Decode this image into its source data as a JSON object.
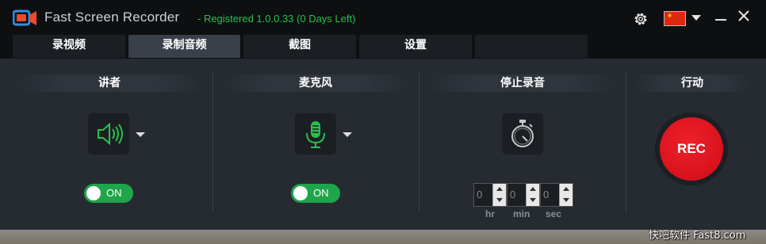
{
  "app": {
    "title": "Fast Screen Recorder",
    "registration": "- Registered 1.0.0.33 (0 Days Left)"
  },
  "titlebar": {
    "icons": [
      "gear-icon",
      "flag-icon",
      "chevron-down-icon",
      "minimize-icon",
      "close-icon"
    ]
  },
  "tabs": [
    {
      "label": "录视频",
      "active": false
    },
    {
      "label": "录制音频",
      "active": true
    },
    {
      "label": "截图",
      "active": false
    },
    {
      "label": "设置",
      "active": false
    },
    {
      "label": "",
      "active": false
    }
  ],
  "sections": {
    "speaker": {
      "title": "讲者",
      "icon": "speaker-icon",
      "toggle": "ON"
    },
    "microphone": {
      "title": "麦克风",
      "icon": "microphone-icon",
      "toggle": "ON"
    },
    "stop": {
      "title": "停止录音",
      "icon": "stopwatch-icon",
      "hr_value": "0",
      "min_value": "0",
      "sec_value": "0",
      "hr_label": "hr",
      "min_label": "min",
      "sec_label": "sec"
    },
    "action": {
      "title": "行动",
      "rec_label": "REC"
    }
  },
  "colors": {
    "accent_green": "#27c24c",
    "toggle_on": "#1fa54a",
    "rec_red": "#e0141e",
    "background": "#262b31"
  },
  "watermark": "快吧软件 Fast8.com"
}
